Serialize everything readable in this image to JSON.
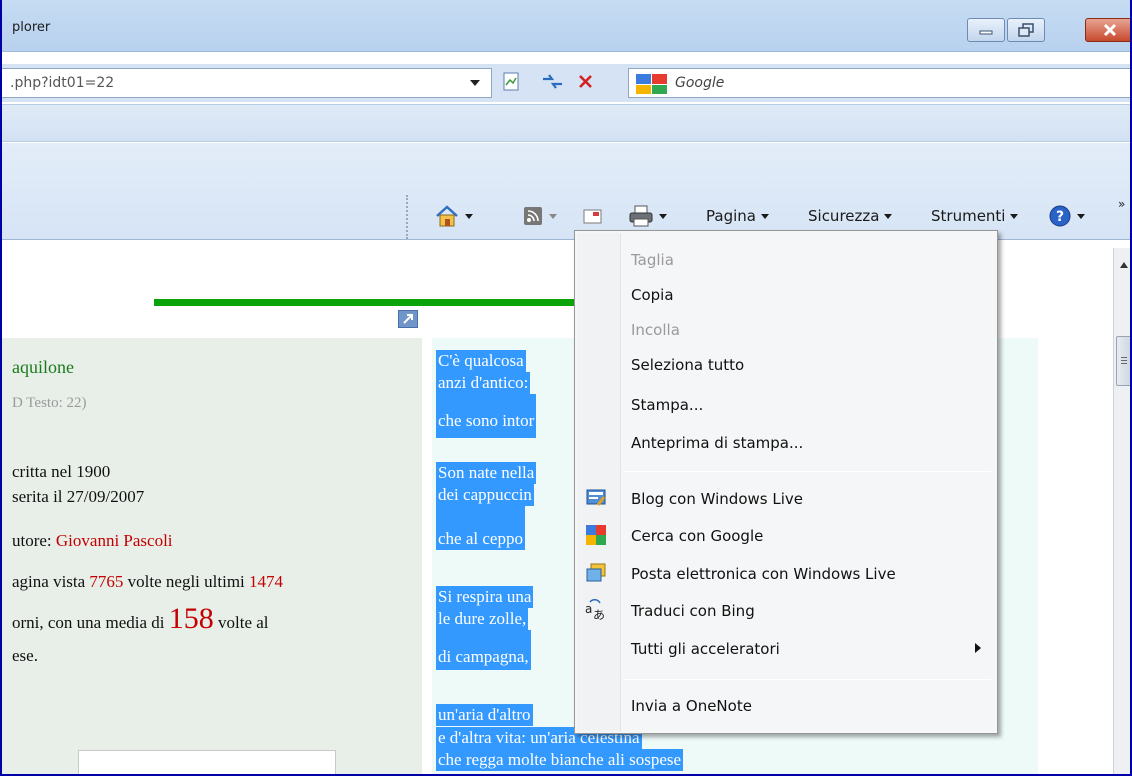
{
  "window": {
    "title": "plorer"
  },
  "address": {
    "url": ".php?idt01=22"
  },
  "search": {
    "placeholder": "Google"
  },
  "commandbar": {
    "pagina": "Pagina",
    "sicurezza": "Sicurezza",
    "strumenti": "Strumenti",
    "chevron": "»"
  },
  "left": {
    "title": "aquilone",
    "id_text": "D Testo: 22)",
    "scritta": "critta nel 1900",
    "inserita": "serita il 27/09/2007",
    "autore_label": "utore: ",
    "autore_name": "Giovanni Pascoli",
    "vista_pre": "agina vista ",
    "vista_count": "7765",
    "vista_mid": " volte negli ultimi ",
    "vista_days": "1474",
    "giorni_pre": "orni, con una media di ",
    "media": "158",
    "giorni_post": " volte al",
    "mese": "ese."
  },
  "poem": {
    "l1": "C'è qualcosa",
    "l2": "anzi d'antico:",
    "l3": "che sono intor",
    "l4": "Son nate nella",
    "l5": "dei cappuccin",
    "l6": "che al ceppo",
    "l7": "Si respira una",
    "l8": "le dure zolle,",
    "l9": "di campagna,",
    "l10": "un'aria d'altro",
    "l11": "e d'altra vita: un'aria celestina",
    "l12": "che regga molte bianche ali sospese"
  },
  "menu": {
    "taglia": "Taglia",
    "copia": "Copia",
    "incolla": "Incolla",
    "seleziona": "Seleziona tutto",
    "stampa": "Stampa...",
    "anteprima": "Anteprima di stampa...",
    "blog": "Blog con Windows Live",
    "cerca": "Cerca con Google",
    "posta": "Posta elettronica con Windows Live",
    "traduci": "Traduci con Bing",
    "acceleratori": "Tutti gli acceleratori",
    "onenote": "Invia a OneNote"
  },
  "colors": {
    "selection": "#3399ff",
    "accent_green": "#0aa30a",
    "link_red": "#c40000"
  }
}
